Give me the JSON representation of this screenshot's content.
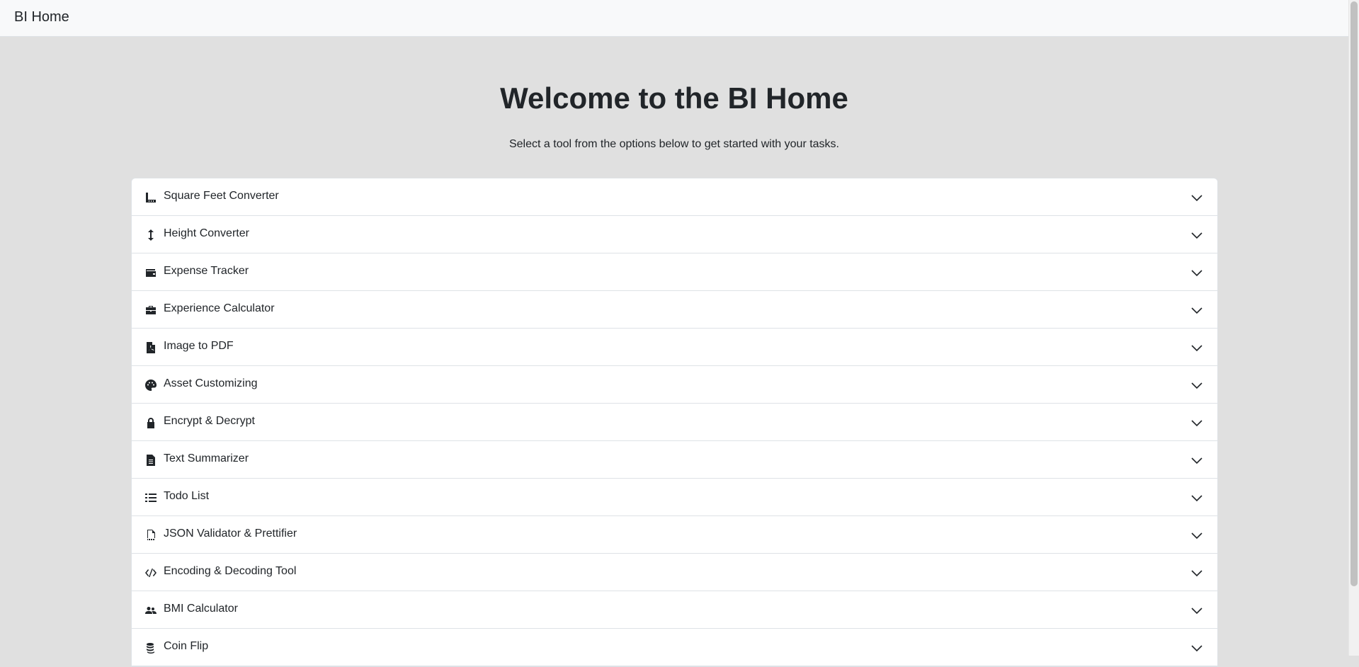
{
  "navbar": {
    "brand": "BI Home"
  },
  "main": {
    "title": "Welcome to the BI Home",
    "subtitle": "Select a tool from the options below to get started with your tasks."
  },
  "accordion": {
    "items": [
      {
        "label": "Square Feet Converter",
        "icon": "ruler-icon"
      },
      {
        "label": "Height Converter",
        "icon": "arrows-vertical-icon"
      },
      {
        "label": "Expense Tracker",
        "icon": "wallet-icon"
      },
      {
        "label": "Experience Calculator",
        "icon": "briefcase-icon"
      },
      {
        "label": "Image to PDF",
        "icon": "file-pdf-icon"
      },
      {
        "label": "Asset Customizing",
        "icon": "palette-icon"
      },
      {
        "label": "Encrypt & Decrypt",
        "icon": "lock-icon"
      },
      {
        "label": "Text Summarizer",
        "icon": "file-text-icon"
      },
      {
        "label": "Todo List",
        "icon": "list-icon"
      },
      {
        "label": "JSON Validator & Prettifier",
        "icon": "file-json-icon"
      },
      {
        "label": "Encoding & Decoding Tool",
        "icon": "code-icon"
      },
      {
        "label": "BMI Calculator",
        "icon": "users-icon"
      },
      {
        "label": "Coin Flip",
        "icon": "coins-icon"
      }
    ]
  },
  "colors": {
    "page_background": "#e0e0e0",
    "navbar_background": "#f8f9fa",
    "card_background": "#ffffff",
    "text": "#212529",
    "border": "#dee2e6"
  }
}
